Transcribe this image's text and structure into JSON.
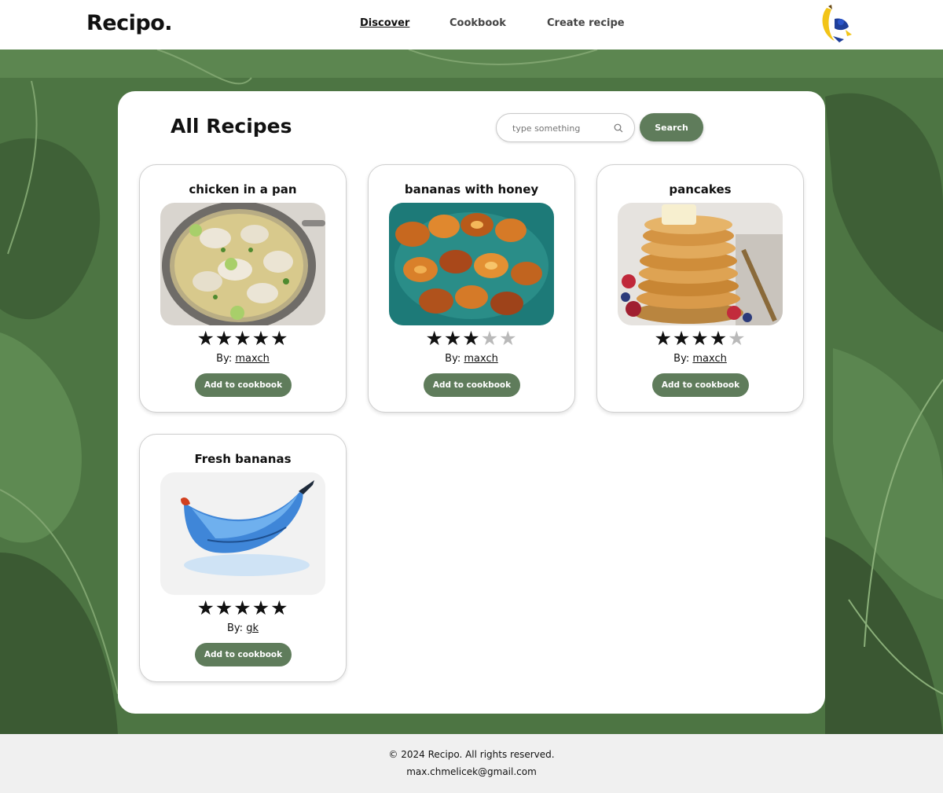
{
  "header": {
    "logo": "Recipo.",
    "nav": [
      {
        "label": "Discover",
        "active": true
      },
      {
        "label": "Cookbook",
        "active": false
      },
      {
        "label": "Create recipe",
        "active": false
      }
    ],
    "avatar_icon": "banana-avatar-icon"
  },
  "main": {
    "title": "All Recipes",
    "search": {
      "placeholder": "type something",
      "value": "",
      "button_label": "Search",
      "icon": "search-icon"
    },
    "recipes": [
      {
        "title": "chicken in a pan",
        "rating": 5,
        "rating_max": 5,
        "by_label": "By:",
        "author": "maxch",
        "button_label": "Add to cookbook"
      },
      {
        "title": "bananas with honey",
        "rating": 3,
        "rating_max": 5,
        "by_label": "By:",
        "author": "maxch",
        "button_label": "Add to cookbook"
      },
      {
        "title": "pancakes",
        "rating": 4,
        "rating_max": 5,
        "by_label": "By:",
        "author": "maxch",
        "button_label": "Add to cookbook"
      },
      {
        "title": "Fresh bananas",
        "rating": 5,
        "rating_max": 5,
        "by_label": "By:",
        "author": "gk",
        "button_label": "Add to cookbook"
      }
    ]
  },
  "footer": {
    "copyright": "© 2024 Recipo. All rights reserved.",
    "email": "max.chmelicek@gmail.com"
  },
  "colors": {
    "accent": "#5f7c5b",
    "background_leaf": "#4f7a44",
    "star_on": "#111111",
    "star_off": "#b9b9b9"
  }
}
